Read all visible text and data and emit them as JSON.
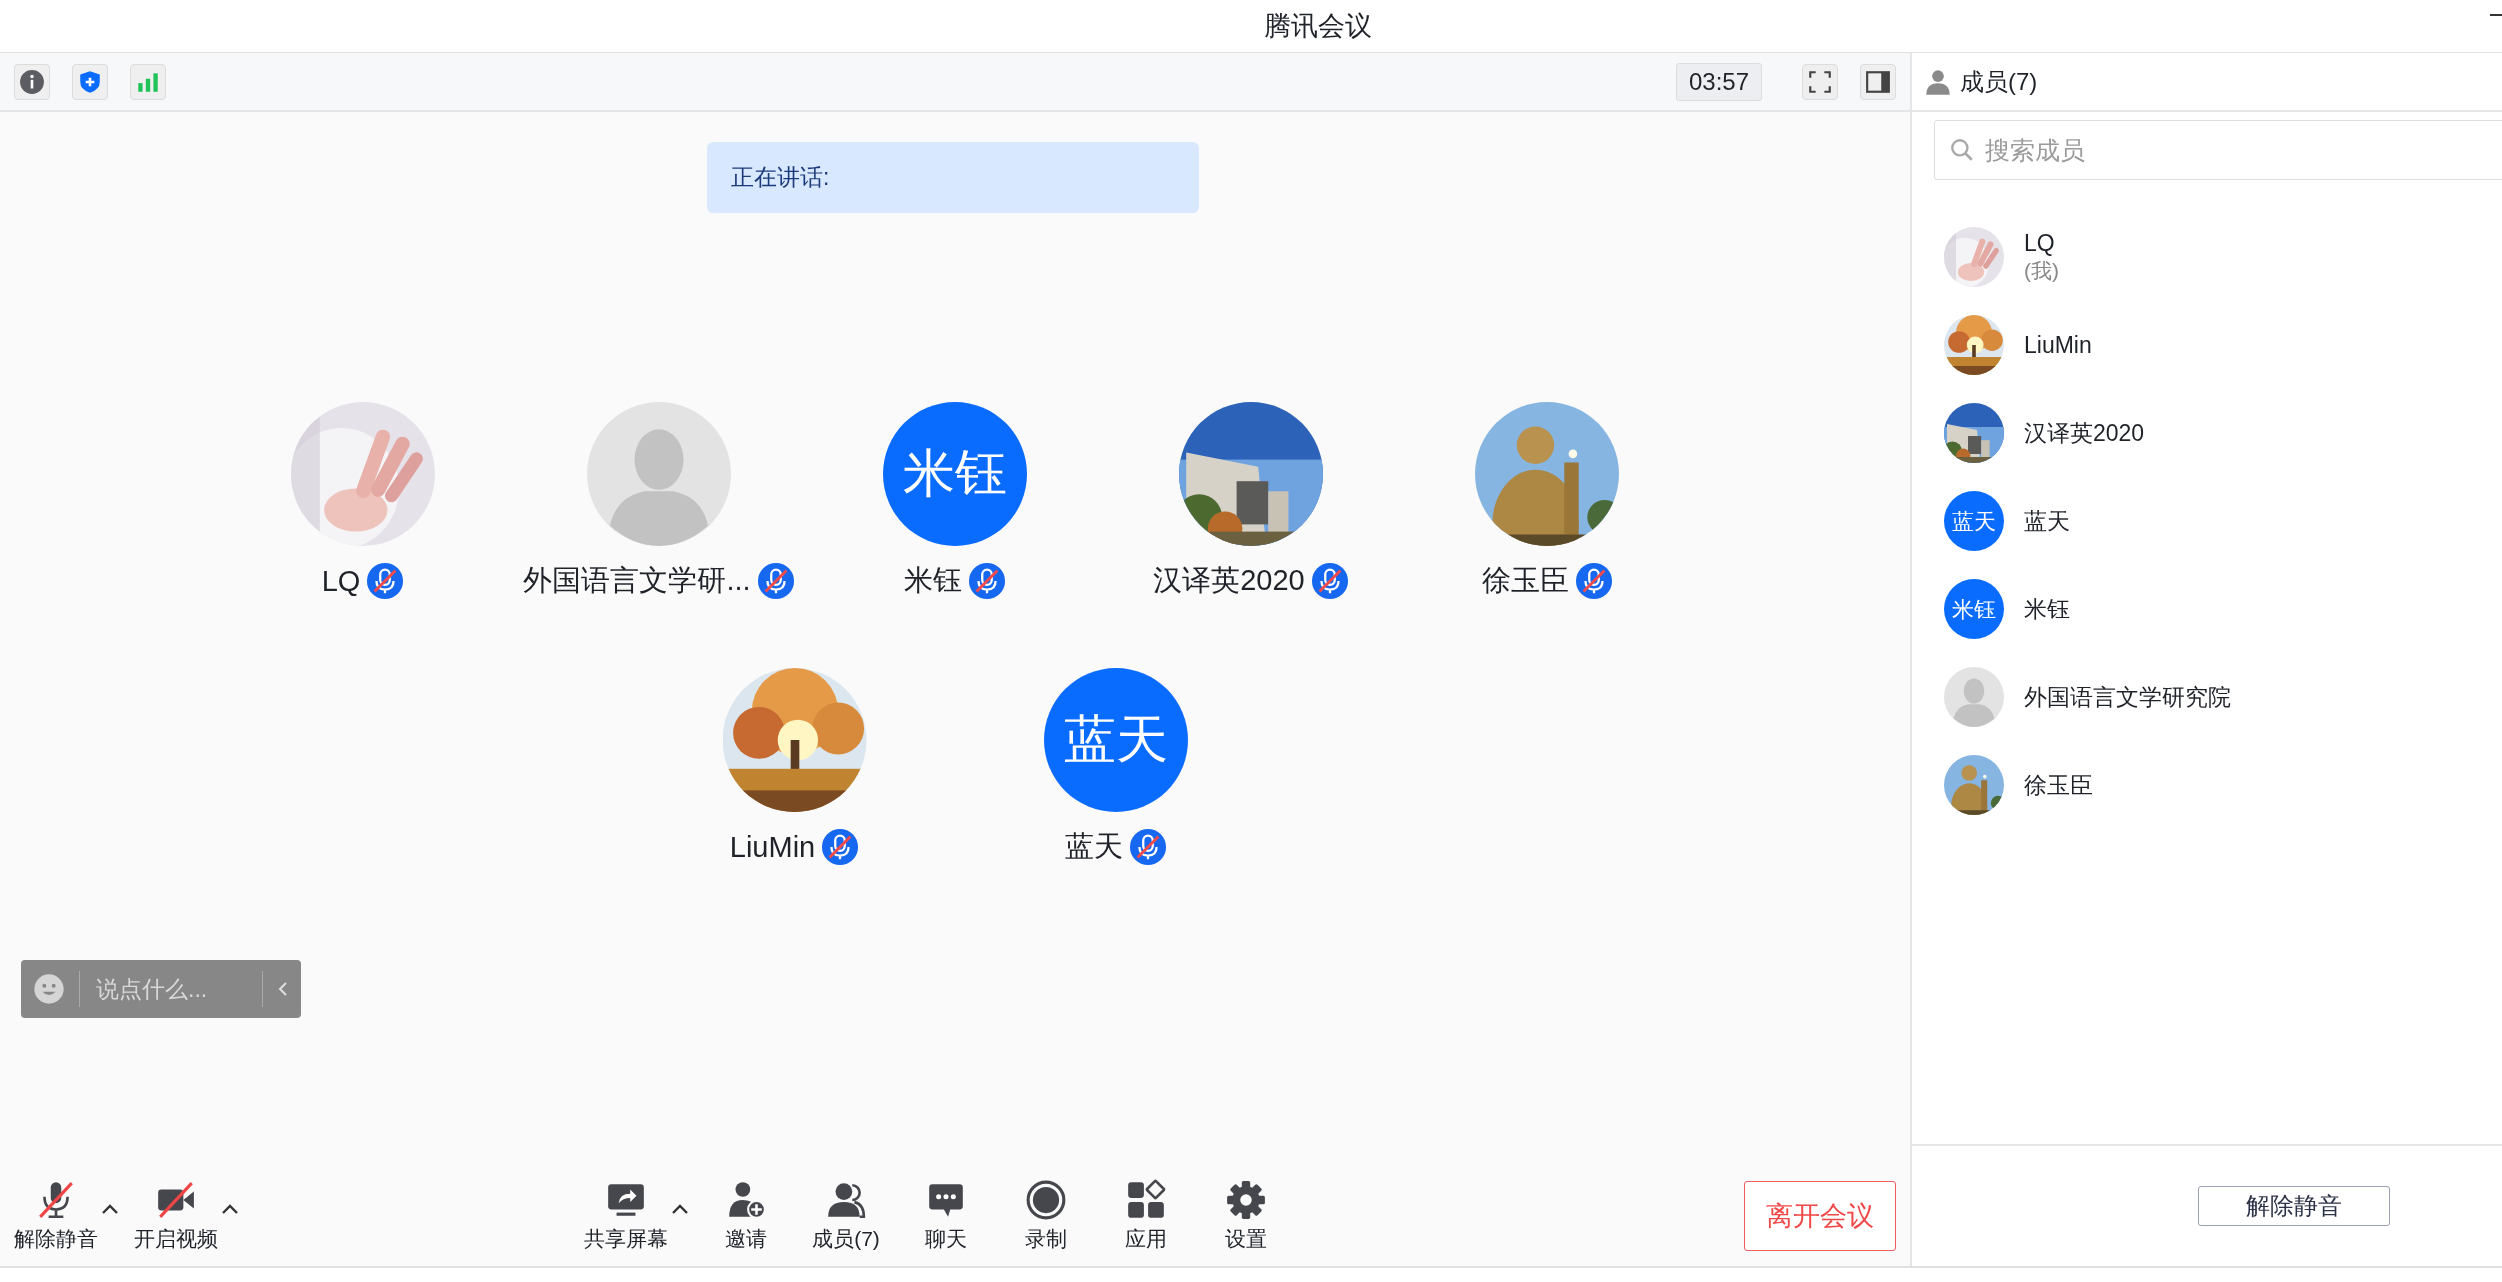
{
  "window": {
    "title": "腾讯会议"
  },
  "top_bar": {
    "timer": "03:57"
  },
  "speaking": {
    "label": "正在讲话:"
  },
  "participants": [
    {
      "name": "LQ",
      "muted": true
    },
    {
      "name": "外国语言文学研...",
      "avatar": {
        "kind": "default"
      },
      "muted": true
    },
    {
      "name": "米钰",
      "avatar": {
        "kind": "text",
        "text": "米钰"
      },
      "muted": true
    },
    {
      "name": "汉译英2020",
      "muted": true
    },
    {
      "name": "徐玉臣",
      "muted": true
    },
    {
      "name": "LiuMin",
      "muted": true
    },
    {
      "name": "蓝天",
      "avatar": {
        "kind": "text",
        "text": "蓝天"
      },
      "muted": true
    }
  ],
  "chat_input": {
    "placeholder": "说点什么..."
  },
  "toolbar": {
    "left": [
      {
        "kind": "mic",
        "label": "解除静音",
        "off": true,
        "caret": true
      },
      {
        "kind": "video",
        "label": "开启视频",
        "off": true,
        "caret": true
      }
    ],
    "center": [
      {
        "kind": "share",
        "label": "共享屏幕",
        "off": false,
        "caret": true
      },
      {
        "kind": "invite",
        "label": "邀请",
        "off": false,
        "caret": false
      },
      {
        "kind": "members",
        "label": "成员(7)",
        "off": false,
        "caret": false
      },
      {
        "kind": "chat",
        "label": "聊天",
        "off": false,
        "caret": false
      },
      {
        "kind": "record",
        "label": "录制",
        "off": false,
        "caret": false
      },
      {
        "kind": "apps",
        "label": "应用",
        "off": false,
        "caret": false
      },
      {
        "kind": "settings",
        "label": "设置",
        "off": false,
        "caret": false
      }
    ]
  },
  "leave_button": "离开会议",
  "members_panel": {
    "title": "成员(7)",
    "search_placeholder": "搜索成员",
    "members": [
      {
        "name": "LQ",
        "note": "(我)"
      },
      {
        "name": "LiuMin"
      },
      {
        "name": "汉译英2020"
      },
      {
        "name": "蓝天",
        "avatar": {
          "kind": "text",
          "text": "蓝天"
        }
      },
      {
        "name": "米钰",
        "avatar": {
          "kind": "text",
          "text": "米钰"
        }
      },
      {
        "name": "外国语言文学研究院",
        "avatar": {
          "kind": "default"
        }
      },
      {
        "name": "徐玉臣"
      }
    ],
    "unmute_button": "解除静音"
  }
}
